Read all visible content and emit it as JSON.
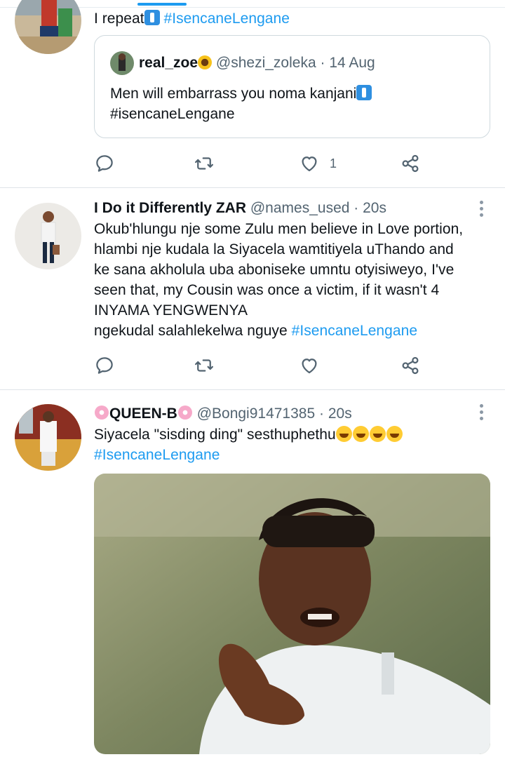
{
  "tweets": [
    {
      "text": "I repeat",
      "hashtag": "#IsencaneLengane",
      "quote": {
        "name": "real_zoe",
        "handle": "@shezi_zoleka",
        "separator": "·",
        "time": "14 Aug",
        "text_line1": "Men will embarrass you noma kanjani",
        "hashtag": "#isencaneLengane"
      },
      "actions": {
        "reply_icon": "reply-icon",
        "retweet_icon": "retweet-icon",
        "like_icon": "heart-icon",
        "like_count": "1",
        "share_icon": "share-icon"
      }
    },
    {
      "name": "I Do it Differently ZAR",
      "handle": "@names_used",
      "separator": "·",
      "time": "20s",
      "text_line1": "Okub'hlungu nje some Zulu men believe in Love portion,",
      "text_line2": "hlambi nje kudala la Siyacela wamtitiyela uThando and",
      "text_line3": "ke sana akholula uba aboniseke umntu otyisiweyo, I've",
      "text_line4": "seen that, my Cousin was once a victim, if it wasn't 4",
      "text_line5": "INYAMA YENGWENYA",
      "text_line6": "ngekudal salahlekelwa nguye ",
      "hashtag": "#IsencaneLengane",
      "actions": {
        "reply_icon": "reply-icon",
        "retweet_icon": "retweet-icon",
        "like_icon": "heart-icon",
        "share_icon": "share-icon"
      }
    },
    {
      "name": "QUEEN-B",
      "handle": "@Bongi91471385",
      "separator": "·",
      "time": "20s",
      "text_line1": "Siyacela \"sisding ding\" sesthuphethu",
      "hashtag": "#IsencaneLengane"
    }
  ],
  "colors": {
    "link": "#1d9bf0",
    "secondary": "#536471",
    "border": "#cfd9de",
    "text": "#0f1419"
  }
}
